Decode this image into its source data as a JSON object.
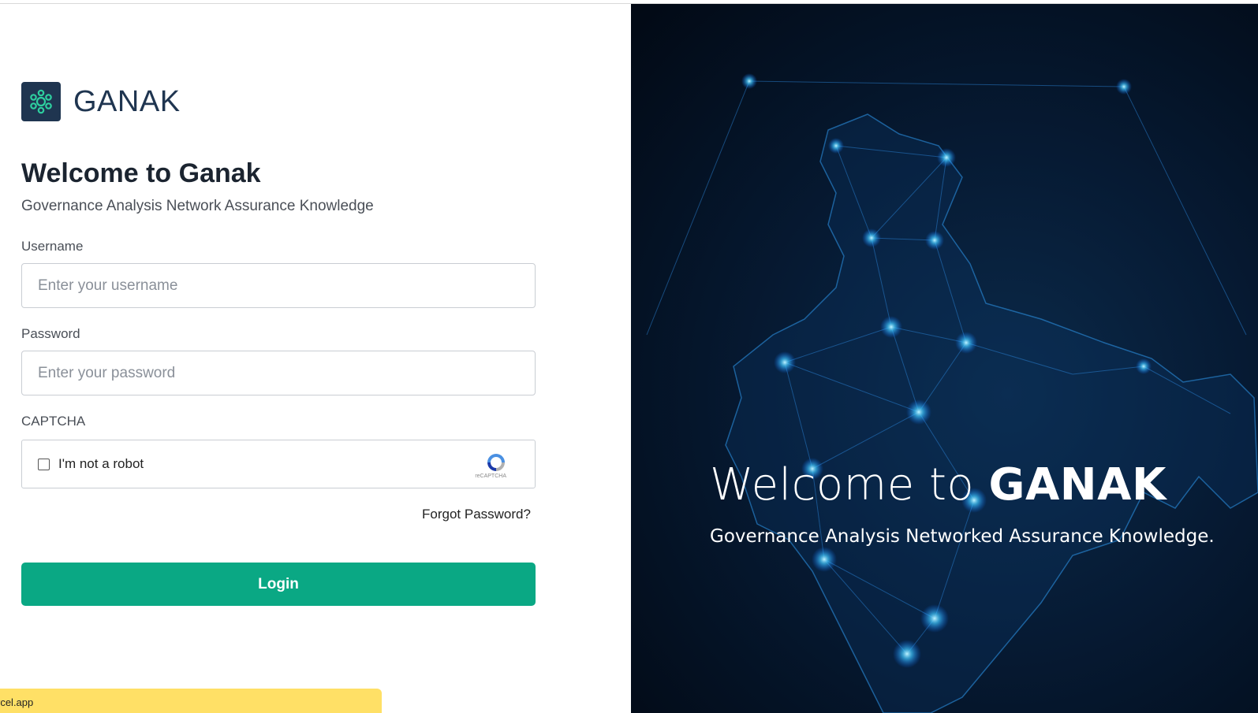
{
  "brand": {
    "name": "GANAK",
    "logo_icon": "hexagon-network-icon"
  },
  "login": {
    "title": "Welcome to Ganak",
    "subtitle": "Governance Analysis Network Assurance Knowledge",
    "username_label": "Username",
    "username_placeholder": "Enter your username",
    "password_label": "Password",
    "password_placeholder": "Enter your password",
    "captcha_label": "CAPTCHA",
    "captcha_text": "I'm not a robot",
    "captcha_brand": "reCAPTCHA",
    "forgot_password": "Forgot Password?",
    "login_button": "Login"
  },
  "hero": {
    "title_prefix": "Welcome to",
    "title_brand": "GANAK",
    "subtitle": "Governance Analysis Networked Assurance Knowledge."
  },
  "toast": {
    "text": "rcel.app"
  },
  "colors": {
    "accent": "#0aa884",
    "brand_dark": "#1f3550",
    "hero_bg": "#061a33",
    "toast": "#ffe066"
  }
}
